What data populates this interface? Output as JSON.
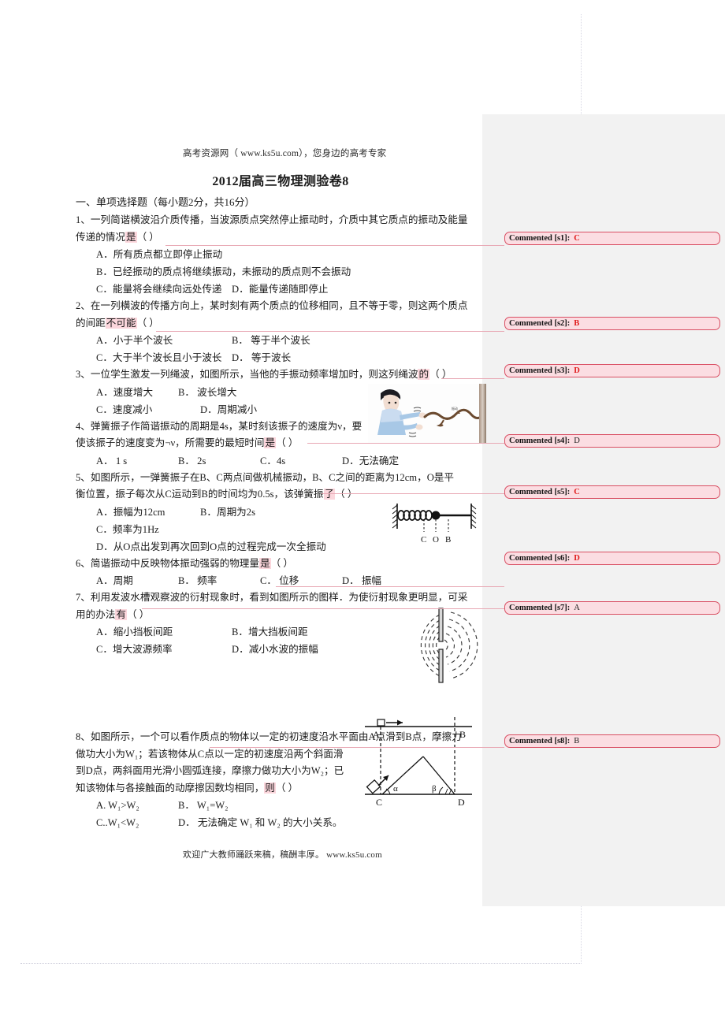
{
  "header": {
    "site_line": "高考资源网（ www.ks5u.com），您身边的高考专家",
    "title": "2012届高三物理测验卷8"
  },
  "section": {
    "heading": "一、单项选择题（每小题2分，共16分）"
  },
  "questions": [
    {
      "stem_a": "1、一列简谐横波沿介质传播，当波源质点突然停止振动时，介质中其它质点的振动及能量",
      "stem_b": "传递的情况",
      "anchor": "是",
      "paren": "（          ）",
      "options": [
        [
          "A．所有质点都立即停止振动",
          ""
        ],
        [
          "B．已经振动的质点将继续振动，未振动的质点则不会振动",
          ""
        ],
        [
          "C．能量将会继续向远处传递",
          "D．能量传递随即停止"
        ]
      ]
    },
    {
      "stem_a": "2、在一列横波的传播方向上，某时刻有两个质点的位移相同，且不等于零，则这两个质点",
      "stem_b": "的间距",
      "anchor": "不可能",
      "paren": "（          ）",
      "options": [
        [
          "A．小于半个波长",
          "B． 等于半个波长"
        ],
        [
          "C．大于半个波长且小于波长",
          "D． 等于波长"
        ]
      ]
    },
    {
      "stem_a": "3、一位学生激发一列绳波，如图所示，当他的手振动频率增加时，则这列绳波",
      "stem_b": "",
      "anchor": "的",
      "paren": "（          ）",
      "options": [
        [
          "A．速度增大",
          "B． 波长增大"
        ],
        [
          "C．速度减小",
          "D．周期减小"
        ]
      ]
    },
    {
      "stem_a": "4、弹簧振子作简谐振动的周期是4s，某时刻该振子的速度为ν，要",
      "stem_b": "使该振子的速度变为¬ν，所需要的最短时间",
      "anchor": "是",
      "paren": "（          ）",
      "options": [
        [
          "A． 1 s",
          "B． 2s",
          "C．4s",
          "D．无法确定"
        ]
      ]
    },
    {
      "stem_a": "5、如图所示，一弹簧振子在B、C两点间做机械振动，B、C之间的距离为12cm，O是平",
      "stem_b": "衡位置，振子每次从C运动到B的时间均为0.5s，该弹簧振",
      "anchor": "子",
      "paren": "（          ）",
      "options": [
        [
          "A．振幅为12cm",
          "B．周期为2s"
        ],
        [
          "C．频率为1Hz",
          ""
        ],
        [
          "D．从O点出发到再次回到O点的过程完成一次全振动",
          ""
        ]
      ]
    },
    {
      "stem_a": "6、简谐振动中反映物体振动强弱的物理量",
      "stem_b": "",
      "anchor": "是",
      "paren": "（          ）",
      "options": [
        [
          "A．周期",
          "B． 频率",
          "C． 位移",
          "D． 振幅"
        ]
      ]
    },
    {
      "stem_a": "7、利用发波水槽观察波的衍射现象时，看到如图所示的图样．为使衍射现象更明显，可采",
      "stem_b": "用的办法",
      "anchor": "有",
      "paren": "（    ）",
      "options": [
        [
          "A．缩小挡板间距",
          "B．增大挡板间距"
        ],
        [
          "C．增大波源频率",
          "D．减小水波的振幅"
        ]
      ]
    },
    {
      "stem_a": "8、如图所示，一个可以看作质点的物体以一定的初速度沿水平面由A点滑到B点，摩擦力",
      "stem_b": "做功大小为W₁；若该物体从C点以一定的初速度沿两个斜面滑",
      "stem_c": "到D点，两斜面用光滑小圆弧连接，摩擦力做功大小为W₂；已",
      "stem_d": "知该物体与各接触面的动摩擦因数均相同，",
      "anchor": "则",
      "paren": "（     ）",
      "options": [
        [
          "A. W₁>W₂",
          "B． W₁=W₂"
        ],
        [
          "C..W₁<W₂",
          "D． 无法确定 W₁ 和 W₂ 的大小关系。"
        ]
      ]
    }
  ],
  "figures": {
    "spring_labels": [
      "C",
      "O",
      "B"
    ],
    "incline_labels": {
      "a": "A",
      "b": "B",
      "c": "C",
      "d": "D",
      "alpha": "α",
      "beta": "β"
    }
  },
  "comments": [
    {
      "label": "Commented [s1]:",
      "value": "C",
      "color": "red"
    },
    {
      "label": "Commented [s2]:",
      "value": "B",
      "color": "red"
    },
    {
      "label": "Commented [s3]:",
      "value": "D",
      "color": "red"
    },
    {
      "label": "Commented [s4]:",
      "value": "D",
      "color": "black"
    },
    {
      "label": "Commented [s5]:",
      "value": "C",
      "color": "red"
    },
    {
      "label": "Commented [s6]:",
      "value": "D",
      "color": "red"
    },
    {
      "label": "Commented [s7]:",
      "value": "A",
      "color": "black"
    },
    {
      "label": "Commented [s8]:",
      "value": "B",
      "color": "black"
    }
  ],
  "footer": {
    "note": "欢迎广大教师踊跃来稿，稿酬丰厚。 www.ks5u.com"
  },
  "colors": {
    "comment_bg": "#fbdde2",
    "comment_border": "#d94f63",
    "highlight": "#fbd6dc",
    "accent_red": "#e01b1b",
    "pane_bg": "#f2f2f2"
  }
}
